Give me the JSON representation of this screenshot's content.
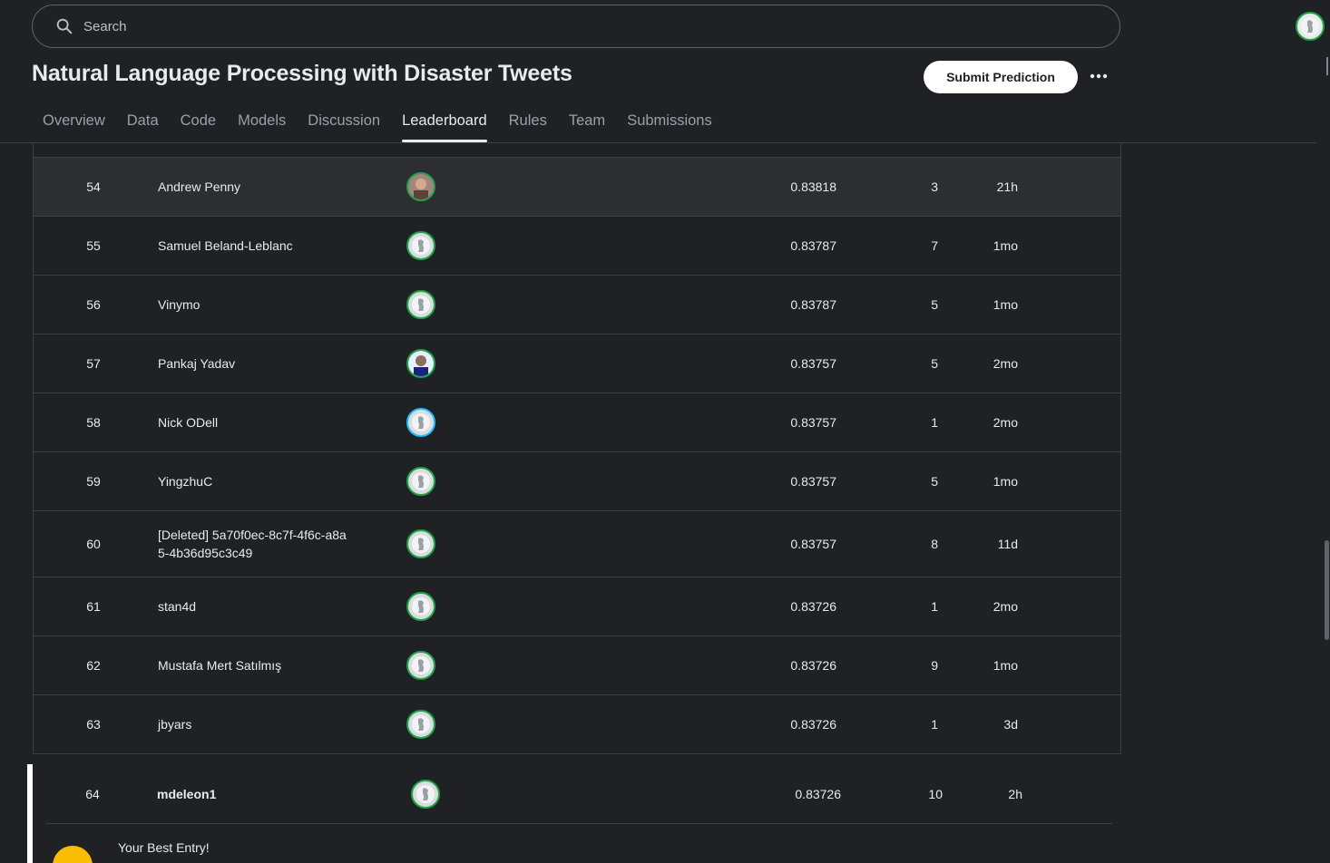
{
  "search": {
    "placeholder": "Search"
  },
  "page": {
    "title": "Natural Language Processing with Disaster Tweets"
  },
  "actions": {
    "submit_label": "Submit Prediction",
    "more_label": "•••"
  },
  "tabs": [
    {
      "label": "Overview"
    },
    {
      "label": "Data"
    },
    {
      "label": "Code"
    },
    {
      "label": "Models"
    },
    {
      "label": "Discussion"
    },
    {
      "label": "Leaderboard",
      "active": true
    },
    {
      "label": "Rules"
    },
    {
      "label": "Team"
    },
    {
      "label": "Submissions"
    }
  ],
  "leaderboard": {
    "rows": [
      {
        "rank": "54",
        "name": "Andrew Penny",
        "score": "0.83818",
        "entries": "3",
        "last": "21h"
      },
      {
        "rank": "55",
        "name": "Samuel Beland-Leblanc",
        "score": "0.83787",
        "entries": "7",
        "last": "1mo"
      },
      {
        "rank": "56",
        "name": "Vinymo",
        "score": "0.83787",
        "entries": "5",
        "last": "1mo"
      },
      {
        "rank": "57",
        "name": "Pankaj Yadav",
        "score": "0.83757",
        "entries": "5",
        "last": "2mo"
      },
      {
        "rank": "58",
        "name": "Nick ODell",
        "score": "0.83757",
        "entries": "1",
        "last": "2mo"
      },
      {
        "rank": "59",
        "name": "YingzhuC",
        "score": "0.83757",
        "entries": "5",
        "last": "1mo"
      },
      {
        "rank": "60",
        "name": "[Deleted] 5a70f0ec-8c7f-4f6c-a8a5-4b36d95c3c49",
        "name_line1": "[Deleted] 5a70f0ec-8c7f-4f6c-a8a",
        "name_line2": "5-4b36d95c3c49",
        "score": "0.83757",
        "entries": "8",
        "last": "11d"
      },
      {
        "rank": "61",
        "name": "stan4d",
        "score": "0.83726",
        "entries": "1",
        "last": "2mo"
      },
      {
        "rank": "62",
        "name": "Mustafa Mert Satılmış",
        "score": "0.83726",
        "entries": "9",
        "last": "1mo"
      },
      {
        "rank": "63",
        "name": "jbyars",
        "score": "0.83726",
        "entries": "1",
        "last": "3d"
      }
    ],
    "you": {
      "rank": "64",
      "name": "mdeleon1",
      "score": "0.83726",
      "entries": "10",
      "last": "2h"
    }
  },
  "best_entry": {
    "title": "Your Best Entry!"
  },
  "colors": {
    "background": "#202124",
    "accent_green": "#1ea446",
    "accent_blue": "#20beff",
    "highlight_row": "#2d2e31"
  }
}
